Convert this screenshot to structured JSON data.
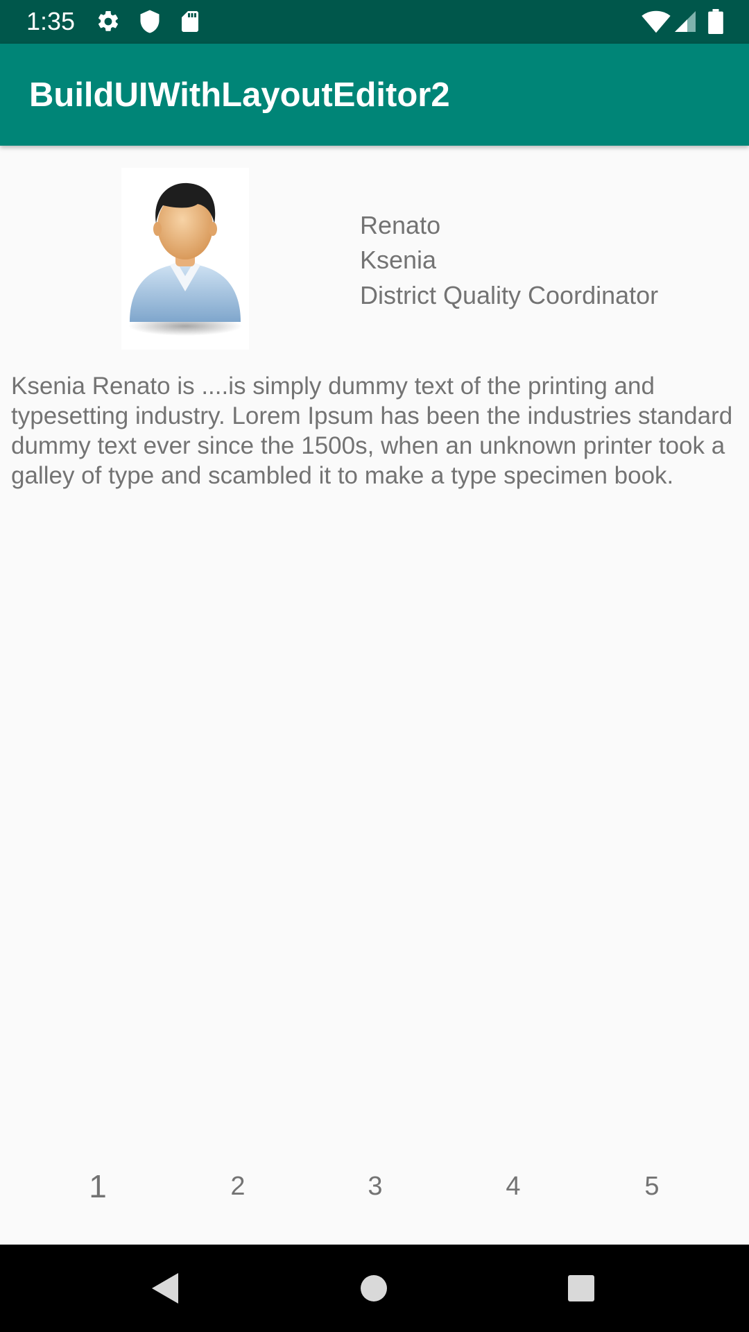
{
  "status_bar": {
    "time": "1:35",
    "icons": [
      "settings-icon",
      "shield-icon",
      "sd-card-icon",
      "wifi-icon",
      "signal-icon",
      "battery-icon"
    ]
  },
  "app_bar": {
    "title": "BuildUIWithLayoutEditor2"
  },
  "profile": {
    "avatar_icon": "person-avatar-icon",
    "first_name": "Renato",
    "last_name": "Ksenia",
    "job_title": "District Quality Coordinator",
    "bio": "Ksenia Renato is ....is simply dummy text of the printing and typesetting industry. Lorem Ipsum has been the industries standard dummy text ever since the 1500s, when an unknown printer took a galley of type and scambled it to make a type specimen book."
  },
  "pager": {
    "items": [
      "1",
      "2",
      "3",
      "4",
      "5"
    ],
    "current": "1"
  },
  "nav_bar": {
    "icons": [
      "back-icon",
      "home-icon",
      "recents-icon"
    ]
  },
  "colors": {
    "status_bar": "#00574b",
    "app_bar": "#008577",
    "background": "#fafafa",
    "text": "#737373"
  }
}
